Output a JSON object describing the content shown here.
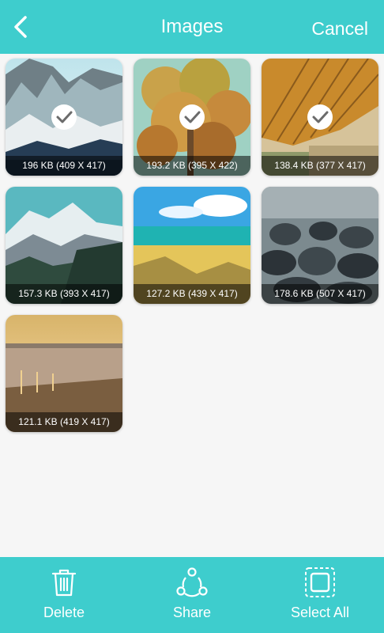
{
  "header": {
    "title": "Images",
    "cancel_label": "Cancel"
  },
  "images": [
    {
      "caption": "196 KB (409 X 417)",
      "selected": true
    },
    {
      "caption": "193.2 KB (395 X 422)",
      "selected": true
    },
    {
      "caption": "138.4 KB (377 X 417)",
      "selected": true
    },
    {
      "caption": "157.3 KB (393 X 417)",
      "selected": false
    },
    {
      "caption": "127.2 KB (439 X 417)",
      "selected": false
    },
    {
      "caption": "178.6 KB (507 X 417)",
      "selected": false
    },
    {
      "caption": "121.1 KB (419 X 417)",
      "selected": false
    }
  ],
  "actions": {
    "delete_label": "Delete",
    "share_label": "Share",
    "select_all_label": "Select All"
  },
  "colors": {
    "accent": "#3ecdcd",
    "background": "#f6f6f6"
  },
  "icons": [
    "back-arrow-icon",
    "checkmark-icon",
    "trash-icon",
    "share-icon",
    "select-all-icon"
  ]
}
